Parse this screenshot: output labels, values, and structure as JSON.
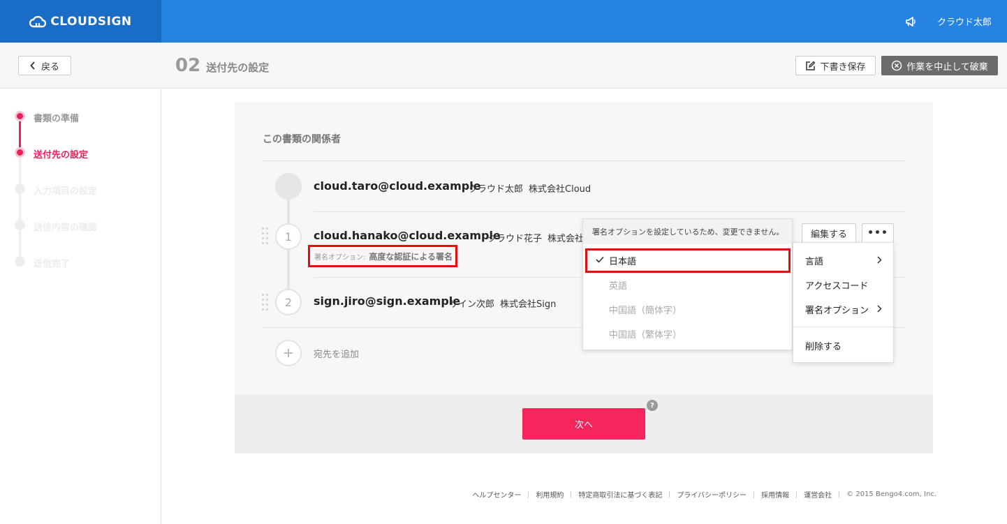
{
  "header": {
    "brand": "CLOUDSIGN",
    "user_name": "クラウド太郎",
    "brand_color": "#1a6dc7",
    "bar_color": "#2683e2"
  },
  "subheader": {
    "back_label": "戻る",
    "step_number": "02",
    "step_title": "送付先の設定",
    "draft_label": "下書き保存",
    "discard_label": "作業を中止して破棄"
  },
  "sidebar": {
    "steps": [
      {
        "label": "書類の準備",
        "state": "done"
      },
      {
        "label": "送付先の設定",
        "state": "current"
      },
      {
        "label": "入力項目の設定",
        "state": "todo"
      },
      {
        "label": "送信内容の確認",
        "state": "todo"
      },
      {
        "label": "送信完了",
        "state": "todo"
      }
    ],
    "accent_color": "#e8215a"
  },
  "main": {
    "section_title": "この書類の関係者",
    "owner": {
      "email": "cloud.taro@cloud.example",
      "name": "クラウド太郎",
      "company": "株式会社Cloud"
    },
    "recipients": [
      {
        "index": "1",
        "email": "cloud.hanako@cloud.example",
        "name": "クラウド花子",
        "company": "株式会社",
        "sign_option_label": "署名オプション:",
        "sign_option_value": "高度な認証による署名"
      },
      {
        "index": "2",
        "email": "sign.jiro@sign.example",
        "name": "サイン次郎",
        "company": "株式会社Sign"
      }
    ],
    "add_recipient_label": "宛先を追加",
    "edit_label": "編集する",
    "more_label": "•••",
    "next_label": "次へ",
    "help_label": "?"
  },
  "language_menu": {
    "note": "署名オプションを設定しているため、変更できません。",
    "options": [
      {
        "label": "日本語",
        "selected": true
      },
      {
        "label": "英語",
        "selected": false
      },
      {
        "label": "中国語（簡体字）",
        "selected": false
      },
      {
        "label": "中国語（繁体字）",
        "selected": false
      }
    ]
  },
  "actions_menu": {
    "items": [
      "言語",
      "アクセスコード",
      "署名オプション",
      "削除する"
    ]
  },
  "footer": {
    "links": [
      "ヘルプセンター",
      "利用規約",
      "特定商取引法に基づく表記",
      "プライバシーポリシー",
      "採用情報",
      "運営会社"
    ],
    "copyright": "© 2015 Bengo4.com, Inc."
  },
  "colors": {
    "next_button": "#f5265c",
    "highlight_box": "#e01010"
  }
}
